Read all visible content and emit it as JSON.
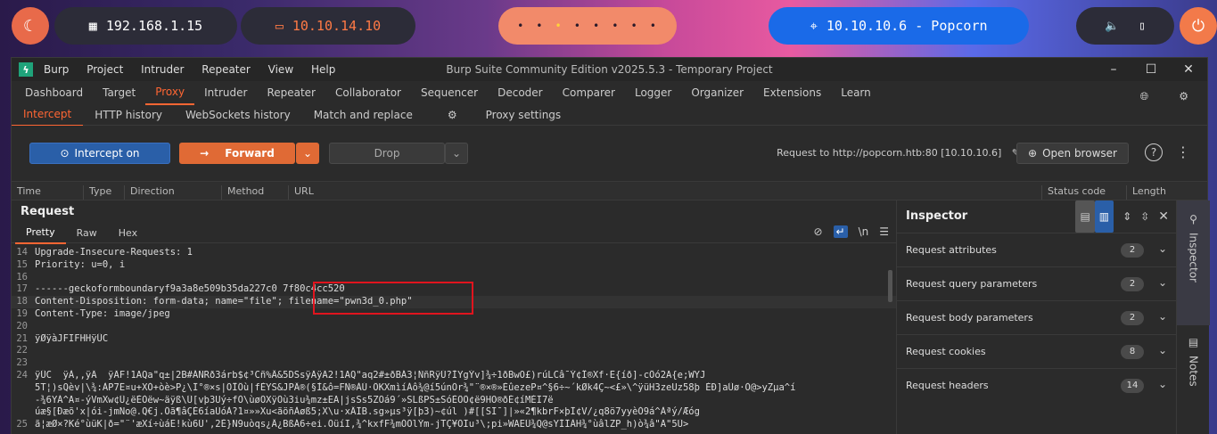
{
  "topbar": {
    "ip_local": "192.168.1.15",
    "ip_vpn": "10.10.14.10",
    "target": "10.10.10.6 - Popcorn",
    "workspace_dots": [
      "•",
      "•",
      "•",
      "•",
      "•",
      "•",
      "•",
      "•"
    ],
    "icons": [
      "kali-icon",
      "network-icon",
      "laptop-icon",
      "crosshair-icon",
      "volume-icon",
      "battery-icon",
      "power-icon"
    ]
  },
  "window": {
    "title": "Burp Suite Community Edition v2025.5.3 - Temporary Project",
    "menu": [
      "Burp",
      "Project",
      "Intruder",
      "Repeater",
      "View",
      "Help"
    ],
    "controls": [
      "–",
      "☐",
      "✕"
    ]
  },
  "main_tabs": [
    "Dashboard",
    "Target",
    "Proxy",
    "Intruder",
    "Repeater",
    "Collaborator",
    "Sequencer",
    "Decoder",
    "Comparer",
    "Logger",
    "Organizer",
    "Extensions",
    "Learn"
  ],
  "proxy_tabs": [
    "Intercept",
    "HTTP history",
    "WebSockets history",
    "Match and replace",
    "Proxy settings"
  ],
  "toolbar": {
    "intercept": "Intercept on",
    "forward": "Forward",
    "drop": "Drop",
    "request_info": "Request to http://popcorn.htb:80  [10.10.10.6]",
    "open_browser": "Open browser"
  },
  "history_columns": [
    "Time",
    "Type",
    "Direction",
    "Method",
    "URL",
    "Status code",
    "Length"
  ],
  "request": {
    "title": "Request",
    "tabs": [
      "Pretty",
      "Raw",
      "Hex"
    ],
    "newline_toggle": "\\n",
    "lines": [
      {
        "n": "14",
        "text": "Upgrade-Insecure-Requests: 1"
      },
      {
        "n": "15",
        "text": "Priority: u=0, i"
      },
      {
        "n": "16",
        "text": ""
      },
      {
        "n": "17",
        "text": "------geckoformboundaryf9a3a8e509b35da227c0 7f80c4cc520"
      },
      {
        "n": "18",
        "text": "Content-Disposition: form-data; name=\"file\"; filename=\"pwn3d_0.php\""
      },
      {
        "n": "19",
        "text": "Content-Type: image/jpeg"
      },
      {
        "n": "20",
        "text": ""
      },
      {
        "n": "21",
        "text": "ÿØÿàJFIFHHÿÛC"
      },
      {
        "n": "22",
        "text": ""
      },
      {
        "n": "23",
        "text": ""
      },
      {
        "n": "24",
        "text": "ÿÛC  ÿÀ,,ÿÄ  ÿÄF!1AQa\"q±|2B#ÁÑRð3árb$¢³Cñ%Â&5DSsÿÄÿÄ2!1AQ\"aq2#±ðBÁ3¦ÑñRÿÚ?ÌYgÝv]¾÷1ðBwO£)rúLCâ¯Ý¢Î®Xf·Ë{íð]-cÔó2Ã{e;WYJ"
      },
      {
        "n": "",
        "text": "5T¦)sQèv|\\¾:ÀP7Ë¤u+XÓ+òè>P¿\\Ï°®×s|ÕÎÔù|fÈYS&JPÂ®(§Ì&ô=FÑ®ÀÚ·ÖKXmìíÁô¾@í5únÖr¾\"¨®×®»ÈûezeP¤^§6÷~´kØk4Ç~<£»\\^ÿüH3zeUz58þ ÈÐ]aÛø·Ò@>yZµa^í"
      },
      {
        "n": "",
        "text": "-¾6YÁ^Ã¤-ýVmXw¢Û¿ëÈÒëw~äÿß\\Ü[vþ3Uý÷fÒ\\ùøÕXÿÕù3iu¾mz±EÃ|jsSs5ZÕá9´»SLßPS±SóÈÖÖ¢ë9HO®ðÉ¢íMÈÏ7ë"
      },
      {
        "n": "",
        "text": "úæ§[Ðæõ'x|ói-jmNo@.Q€j.Ôã¶âÇÈ6íaÙóÀ?1¤»»Xu<ãöñÀøß5;X\\u·xÂÏB.sg»µs³ÿ[þ3)~¢úl )#[[SI¯]|»«2¶kbrF×þÏ¢V/¿q8ö7yyèÓ9á^Àªý/Æóg"
      },
      {
        "n": "25",
        "text": "ã¦æØ×?Ké°ùüK|ð=\"¨'æXí÷ùáE!kù6Ú',2È}N9uòqs¿Â¿BßÁ6÷ei.ÖüíI,¾^kxfF¾mÓÕlÝm-jTÇ¥ÕIu³\\;pi»WAEÜ¾Q@sYÍÏÀH¾°ùâlZP_h)ò¾â\"Ä\"5Ù>"
      }
    ]
  },
  "inspector": {
    "title": "Inspector",
    "rows": [
      {
        "label": "Request attributes",
        "count": "2"
      },
      {
        "label": "Request query parameters",
        "count": "2"
      },
      {
        "label": "Request body parameters",
        "count": "2"
      },
      {
        "label": "Request cookies",
        "count": "8"
      },
      {
        "label": "Request headers",
        "count": "14"
      }
    ]
  },
  "side_tabs": [
    "Inspector",
    "Notes"
  ],
  "colors": {
    "accent": "#ff6633",
    "intercept_btn": "#2a5fa8",
    "forward_btn": "#e06a35",
    "highlight_box": "#e0141e"
  }
}
